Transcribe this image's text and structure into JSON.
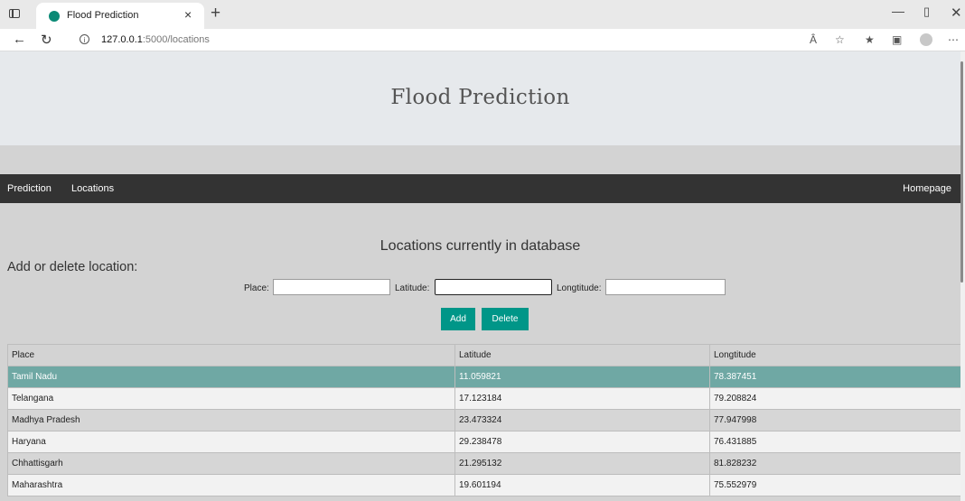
{
  "browser": {
    "tab_title": "Flood Prediction",
    "tab_close": "×",
    "new_tab": "+",
    "url_host": "127.0.0.1",
    "url_path": ":5000/locations",
    "icons": [
      "tab-strip-icon",
      "favicon-icon",
      "back-icon",
      "reload-icon",
      "info-icon",
      "read-aloud-icon",
      "favorite-icon",
      "favorites-list-icon",
      "collections-icon",
      "profile-icon",
      "more-icon"
    ]
  },
  "header": {
    "title": "Flood Prediction"
  },
  "nav": {
    "prediction": "Prediction",
    "locations": "Locations",
    "homepage": "Homepage"
  },
  "main": {
    "db_heading": "Locations currently in database",
    "form_heading": "Add or delete location:",
    "form": {
      "place_label": "Place:",
      "latitude_label": "Latitude:",
      "longitude_label": "Longtitude:",
      "place_value": "",
      "latitude_value": "",
      "longitude_value": "",
      "add_label": "Add",
      "delete_label": "Delete"
    },
    "table": {
      "headers": [
        "Place",
        "Latitude",
        "Longtitude"
      ],
      "rows": [
        [
          "Tamil Nadu",
          "11.059821",
          "78.387451"
        ],
        [
          "Telangana",
          "17.123184",
          "79.208824"
        ],
        [
          "Madhya Pradesh",
          "23.473324",
          "77.947998"
        ],
        [
          "Haryana",
          "29.238478",
          "76.431885"
        ],
        [
          "Chhattisgarh",
          "21.295132",
          "81.828232"
        ],
        [
          "Maharashtra",
          "19.601194",
          "75.552979"
        ]
      ]
    }
  },
  "colors": {
    "accent": "#009688",
    "navbar": "#333333",
    "selected_row": "#6fa8a4",
    "page_bg": "#d3d3d3",
    "header_bg": "#e6e9ec"
  }
}
